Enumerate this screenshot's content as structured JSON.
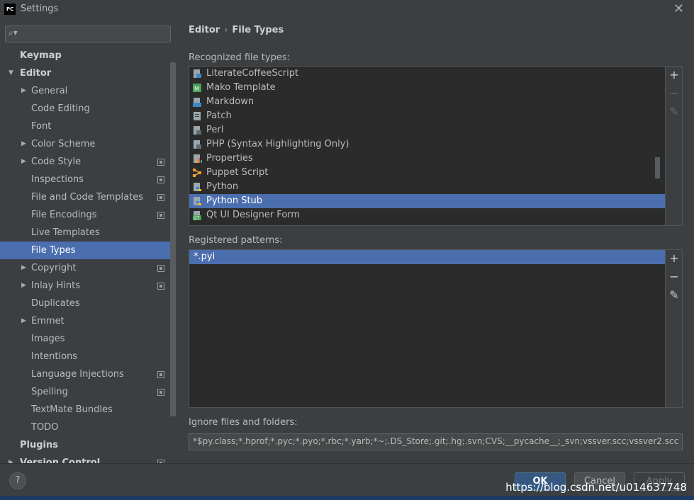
{
  "window": {
    "title": "Settings",
    "logo_text": "PC"
  },
  "sidebar": {
    "search": {
      "value": "",
      "placeholder": ""
    },
    "items": [
      {
        "label": "Keymap"
      },
      {
        "label": "Editor"
      },
      {
        "label": "General"
      },
      {
        "label": "Code Editing"
      },
      {
        "label": "Font"
      },
      {
        "label": "Color Scheme"
      },
      {
        "label": "Code Style"
      },
      {
        "label": "Inspections"
      },
      {
        "label": "File and Code Templates"
      },
      {
        "label": "File Encodings"
      },
      {
        "label": "Live Templates"
      },
      {
        "label": "File Types"
      },
      {
        "label": "Copyright"
      },
      {
        "label": "Inlay Hints"
      },
      {
        "label": "Duplicates"
      },
      {
        "label": "Emmet"
      },
      {
        "label": "Images"
      },
      {
        "label": "Intentions"
      },
      {
        "label": "Language Injections"
      },
      {
        "label": "Spelling"
      },
      {
        "label": "TextMate Bundles"
      },
      {
        "label": "TODO"
      },
      {
        "label": "Plugins"
      },
      {
        "label": "Version Control"
      }
    ]
  },
  "breadcrumb": {
    "parent": "Editor",
    "separator": "›",
    "current": "File Types"
  },
  "recognized": {
    "label": "Recognized file types:",
    "items": [
      {
        "label": "LiterateCoffeeScript"
      },
      {
        "label": "Mako Template"
      },
      {
        "label": "Markdown"
      },
      {
        "label": "Patch"
      },
      {
        "label": "Perl"
      },
      {
        "label": "PHP (Syntax Highlighting Only)"
      },
      {
        "label": "Properties"
      },
      {
        "label": "Puppet Script"
      },
      {
        "label": "Python"
      },
      {
        "label": "Python Stub"
      },
      {
        "label": "Qt UI Designer Form"
      }
    ],
    "selected_index": 9
  },
  "patterns": {
    "label": "Registered patterns:",
    "items": [
      {
        "label": "*.pyi"
      }
    ]
  },
  "tools": {
    "add": "+",
    "remove": "−",
    "edit": "✎"
  },
  "ignore": {
    "label": "Ignore files and folders:",
    "value": "*$py.class;*.hprof;*.pyc;*.pyo;*.rbc;*.yarb;*~;.DS_Store;.git;.hg;.svn;CVS;__pycache__;_svn;vssver.scc;vssver2.scc;"
  },
  "footer": {
    "help": "?",
    "ok": "OK",
    "cancel": "Cancel",
    "apply": "Apply",
    "watermark": "https://blog.csdn.net/u014637748"
  },
  "colors": {
    "accent": "#4b6eaf",
    "background": "#3c3f41",
    "list_background": "#2b2b2b"
  }
}
